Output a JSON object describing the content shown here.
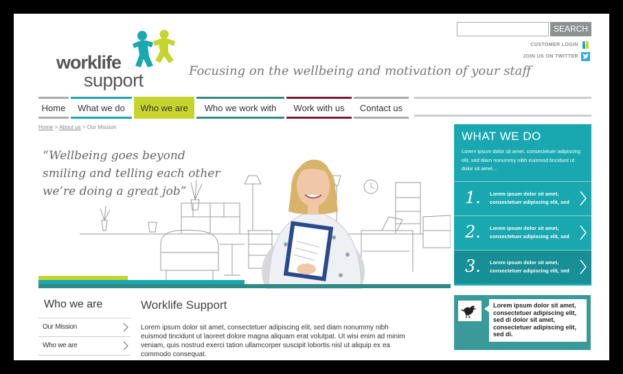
{
  "header": {
    "search_button": "SEARCH",
    "search_value": "",
    "customer_login": "CUSTOMER LOGIN",
    "join_twitter": "JOIN US ON TWITTER",
    "logo_line1": "worklife",
    "logo_line2": "support",
    "tagline": "Focusing on the wellbeing and motivation of your staff"
  },
  "nav": [
    {
      "label": "Home",
      "color": "#aaaaaa"
    },
    {
      "label": "What we do",
      "color": "#1aa8b0"
    },
    {
      "label": "Who we are",
      "color": "#c8d42e"
    },
    {
      "label": "Who we work with",
      "color": "#2e8a86"
    },
    {
      "label": "Work with us",
      "color": "#7a1a2e"
    },
    {
      "label": "Contact us",
      "color": "#aaaaaa"
    }
  ],
  "breadcrumb": {
    "home": "Home",
    "sep": " > ",
    "about": "About us",
    "current": "Our Mission"
  },
  "hero": {
    "quote": "“Wellbeing goes beyond smiling and telling each other we’re doing a great job”"
  },
  "what_we_do": {
    "title": "WHAT WE DO",
    "intro": "Lorem ipsum dolor sit amet, consectetuer adipiscing elit, sed diam nonummy nibh euismod tincidunt ut  dolor sit amet...",
    "items": [
      {
        "num": "1.",
        "text": "Lorem ipsum dolor sit amet, consectetuer adipiscing elit, sed"
      },
      {
        "num": "2.",
        "text": "Lorem ipsum dolor sit amet, consectetuer adipiscing elit, sed"
      },
      {
        "num": "3.",
        "text": "Lorem ipsum dolor sit amet, consectetuer adipiscing elit, sed"
      }
    ]
  },
  "who_we_are": {
    "title": "Who we are",
    "links": [
      "Our Mission",
      "Who we are"
    ]
  },
  "content": {
    "title": "Worklife Support",
    "body": "Lorem ipsum dolor sit amet, consectetuer adipiscing elit, sed diam nonummy nibh euismod tincidunt ut laoreet dolore magna aliquam erat volutpat. Ut wisi enim ad minim veniam, quis nostrud exerci tation ullamcorper suscipit lobortis nisl ut aliquip ex ea commodo consequat."
  },
  "twitter": {
    "text": "Lorem ipsum dolor sit amet, consectetuer adipiscing elit, sed di dolor sit amet, consectetuer adipiscing elit, sed di."
  },
  "colors": {
    "teal": "#1aa8b0",
    "lime": "#c8d42e",
    "dark_teal": "#2e8a86",
    "maroon": "#7a1a2e",
    "twitter_blue": "#2aa9e0"
  }
}
